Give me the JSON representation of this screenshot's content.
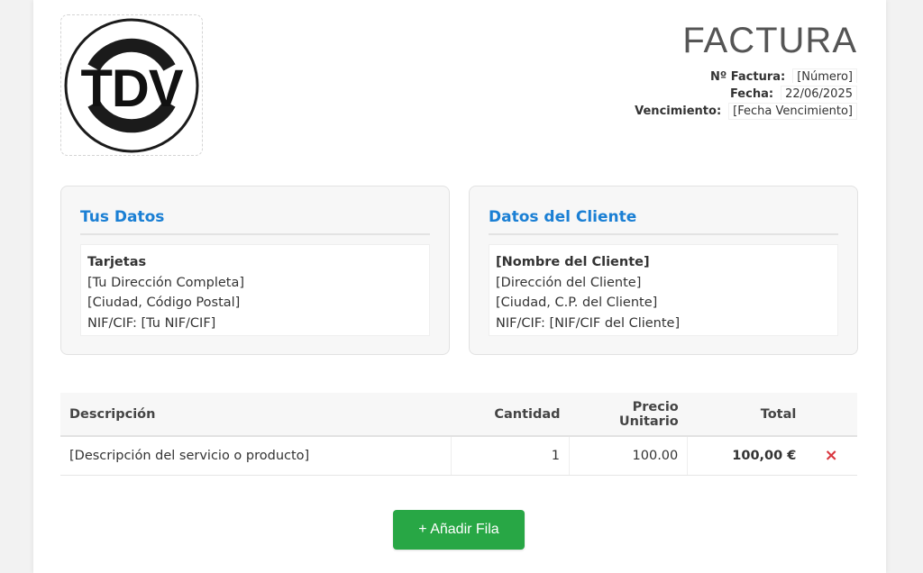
{
  "header": {
    "logo_text": "TDV",
    "title": "FACTURA",
    "meta": [
      {
        "label": "Nº Factura:",
        "value": "[Número]"
      },
      {
        "label": "Fecha:",
        "value": "22/06/2025"
      },
      {
        "label": "Vencimiento:",
        "value": "[Fecha Vencimiento]"
      }
    ]
  },
  "issuer": {
    "title": "Tus Datos",
    "name": "Tarjetas",
    "address": "[Tu Dirección Completa]",
    "city": "[Ciudad, Código Postal]",
    "tax_id": "NIF/CIF: [Tu NIF/CIF]"
  },
  "client": {
    "title": "Datos del Cliente",
    "name": "[Nombre del Cliente]",
    "address": "[Dirección del Cliente]",
    "city": "[Ciudad, C.P. del Cliente]",
    "tax_id": "NIF/CIF: [NIF/CIF del Cliente]"
  },
  "table": {
    "columns": [
      "Descripción",
      "Cantidad",
      "Precio Unitario",
      "Total"
    ],
    "rows": [
      {
        "description": "[Descripción del servicio o producto]",
        "quantity": "1",
        "unit_price": "100.00",
        "total": "100,00 €",
        "delete_icon": "×"
      }
    ]
  },
  "actions": {
    "add_row_label": "+ Añadir Fila"
  },
  "colors": {
    "accent_blue": "#1a7fd4",
    "add_green": "#28a745",
    "delete_red": "#d9363e"
  }
}
